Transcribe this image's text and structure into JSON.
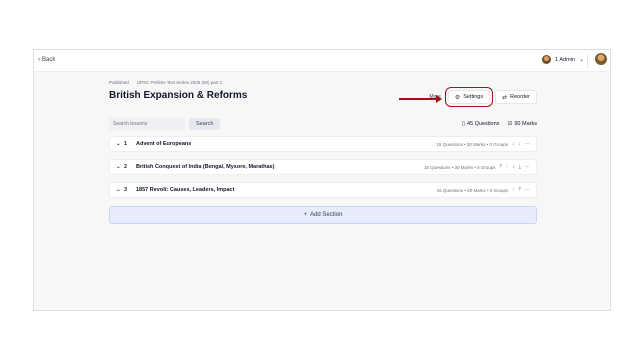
{
  "topbar": {
    "back_label": "Back",
    "admin_label": "1 Admin"
  },
  "breadcrumb": {
    "status": "Published",
    "path": "UPSC Prelims Test Series 2025 (00) part 1"
  },
  "page": {
    "title": "British Expansion & Reforms"
  },
  "actions": {
    "more_label": "More",
    "settings_label": "Settings",
    "reorder_label": "Reorder"
  },
  "search": {
    "placeholder": "Search lessons",
    "button_label": "Search"
  },
  "stats": {
    "questions": "45 Questions",
    "marks": "90 Marks"
  },
  "sections": [
    {
      "number": "1",
      "name": "Advent of Europeans",
      "meta": "15 Questions • 30 Marks • 0 Groups",
      "tools": [
        "↓",
        "↓",
        "⋯"
      ]
    },
    {
      "number": "2",
      "name": "British Conquest of India (Bengal, Mysore, Marathas)",
      "meta": "15 Questions • 30 Marks • 0 Groups",
      "tools": [
        "⤒",
        "↑",
        "↓",
        "⤓",
        "⋯"
      ]
    },
    {
      "number": "3",
      "name": "1857 Revolt: Causes, Leaders, Impact",
      "meta": "15 Questions • 30 Marks • 0 Groups",
      "tools": [
        "↑",
        "⤒",
        "⋯"
      ]
    }
  ],
  "add_section_label": "Add Section",
  "colors": {
    "highlight": "#a3101b",
    "add_section_bg": "#e7ebfb"
  }
}
